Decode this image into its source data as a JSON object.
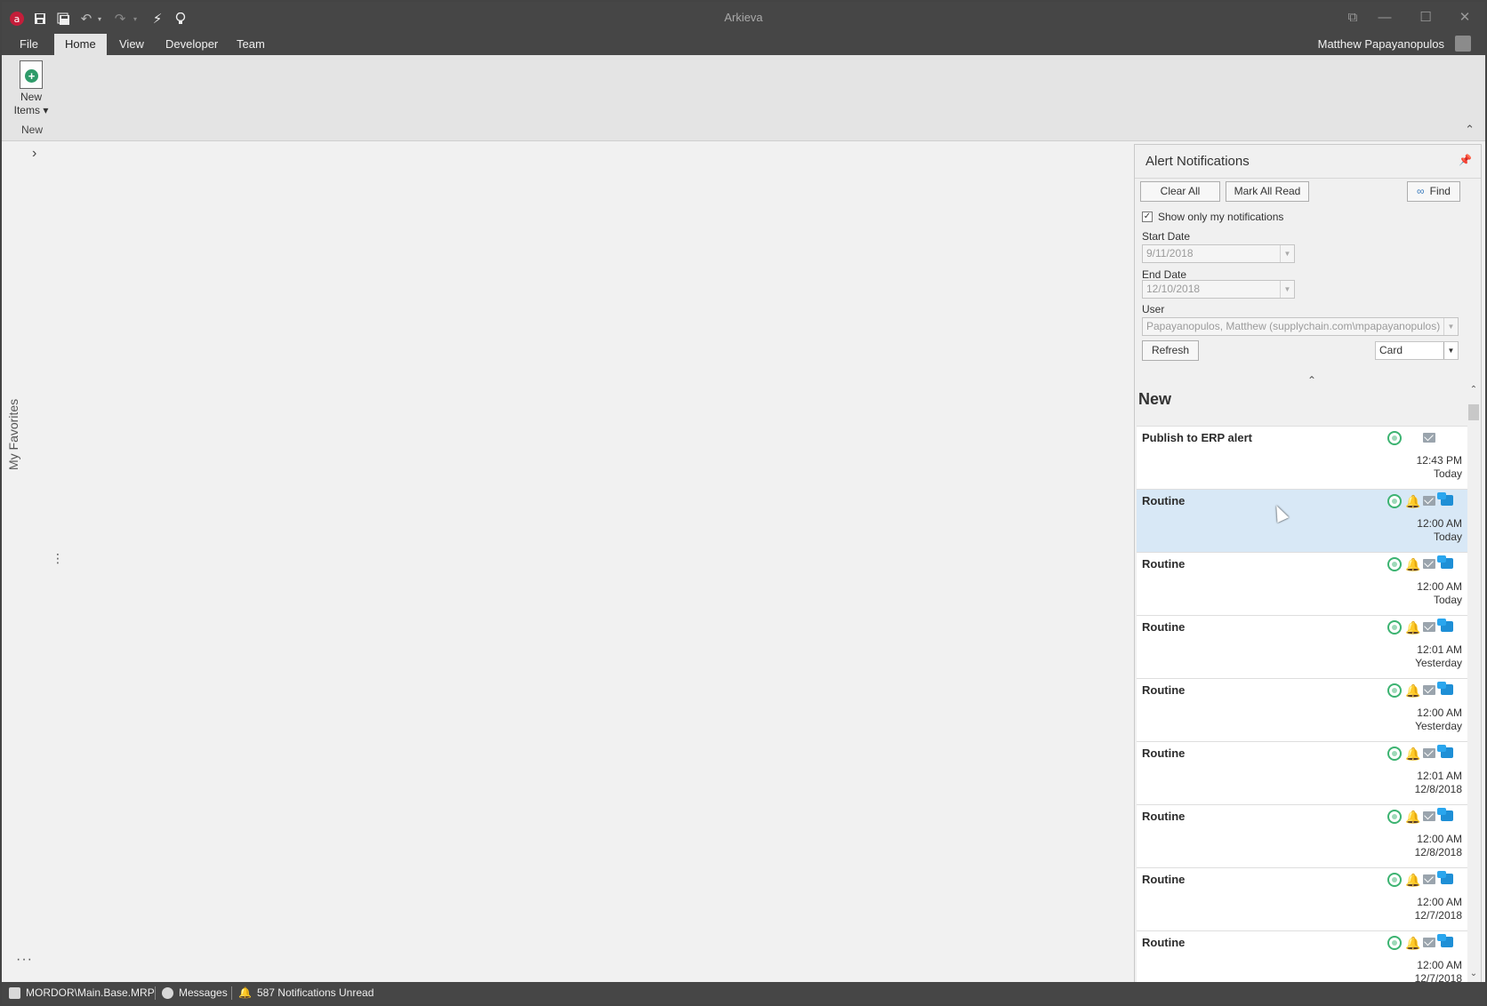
{
  "window": {
    "title": "Arkieva",
    "user_name": "Matthew Papayanopulos"
  },
  "menu": {
    "tabs": [
      {
        "label": "File"
      },
      {
        "label": "Home"
      },
      {
        "label": "View"
      },
      {
        "label": "Developer"
      },
      {
        "label": "Team"
      }
    ],
    "active_tab": "Home"
  },
  "ribbon": {
    "new_items_line1": "New",
    "new_items_line2": "Items ▾",
    "group_label": "New"
  },
  "sidebar": {
    "favorites_label": "My Favorites",
    "more_label": "···"
  },
  "alerts": {
    "title": "Alert Notifications",
    "clear_all": "Clear All",
    "mark_all_read": "Mark All Read",
    "find": "Find",
    "show_only_mine_label": "Show only my notifications",
    "show_only_mine_checked": true,
    "start_date_label": "Start Date",
    "start_date_value": "9/11/2018",
    "end_date_label": "End Date",
    "end_date_value": "12/10/2018",
    "user_label": "User",
    "user_value": "Papayanopulos, Matthew (supplychain.com\\mpapayanopulos)",
    "refresh": "Refresh",
    "view_mode": "Card",
    "group_title": "New",
    "items": [
      {
        "title": "Publish to ERP alert",
        "time": "12:43 PM",
        "day": "Today",
        "icons": [
          "message",
          "mail"
        ],
        "selected": false
      },
      {
        "title": "Routine",
        "time": "12:00 AM",
        "day": "Today",
        "icons": [
          "message",
          "bell",
          "mail",
          "chat"
        ],
        "selected": true
      },
      {
        "title": "Routine",
        "time": "12:00 AM",
        "day": "Today",
        "icons": [
          "message",
          "bell",
          "mail",
          "chat"
        ],
        "selected": false
      },
      {
        "title": "Routine",
        "time": "12:01 AM",
        "day": "Yesterday",
        "icons": [
          "message",
          "bell",
          "mail",
          "chat"
        ],
        "selected": false
      },
      {
        "title": "Routine",
        "time": "12:00 AM",
        "day": "Yesterday",
        "icons": [
          "message",
          "bell",
          "mail",
          "chat"
        ],
        "selected": false
      },
      {
        "title": "Routine",
        "time": "12:01 AM",
        "day": "12/8/2018",
        "icons": [
          "message",
          "bell",
          "mail",
          "chat"
        ],
        "selected": false
      },
      {
        "title": "Routine",
        "time": "12:00 AM",
        "day": "12/8/2018",
        "icons": [
          "message",
          "bell",
          "mail",
          "chat"
        ],
        "selected": false
      },
      {
        "title": "Routine",
        "time": "12:00 AM",
        "day": "12/7/2018",
        "icons": [
          "message",
          "bell",
          "mail",
          "chat"
        ],
        "selected": false
      },
      {
        "title": "Routine",
        "time": "12:00 AM",
        "day": "12/7/2018",
        "icons": [
          "message",
          "bell",
          "mail",
          "chat"
        ],
        "selected": false
      }
    ]
  },
  "status_bar": {
    "connection": "MORDOR\\Main.Base.MRP",
    "messages": "Messages",
    "notifications": "587 Notifications Unread"
  },
  "colors": {
    "titlebar": "#464646",
    "ribbon": "#e4e4e4",
    "selected_card": "#d8e8f6",
    "brand_red": "#c41e3a"
  }
}
